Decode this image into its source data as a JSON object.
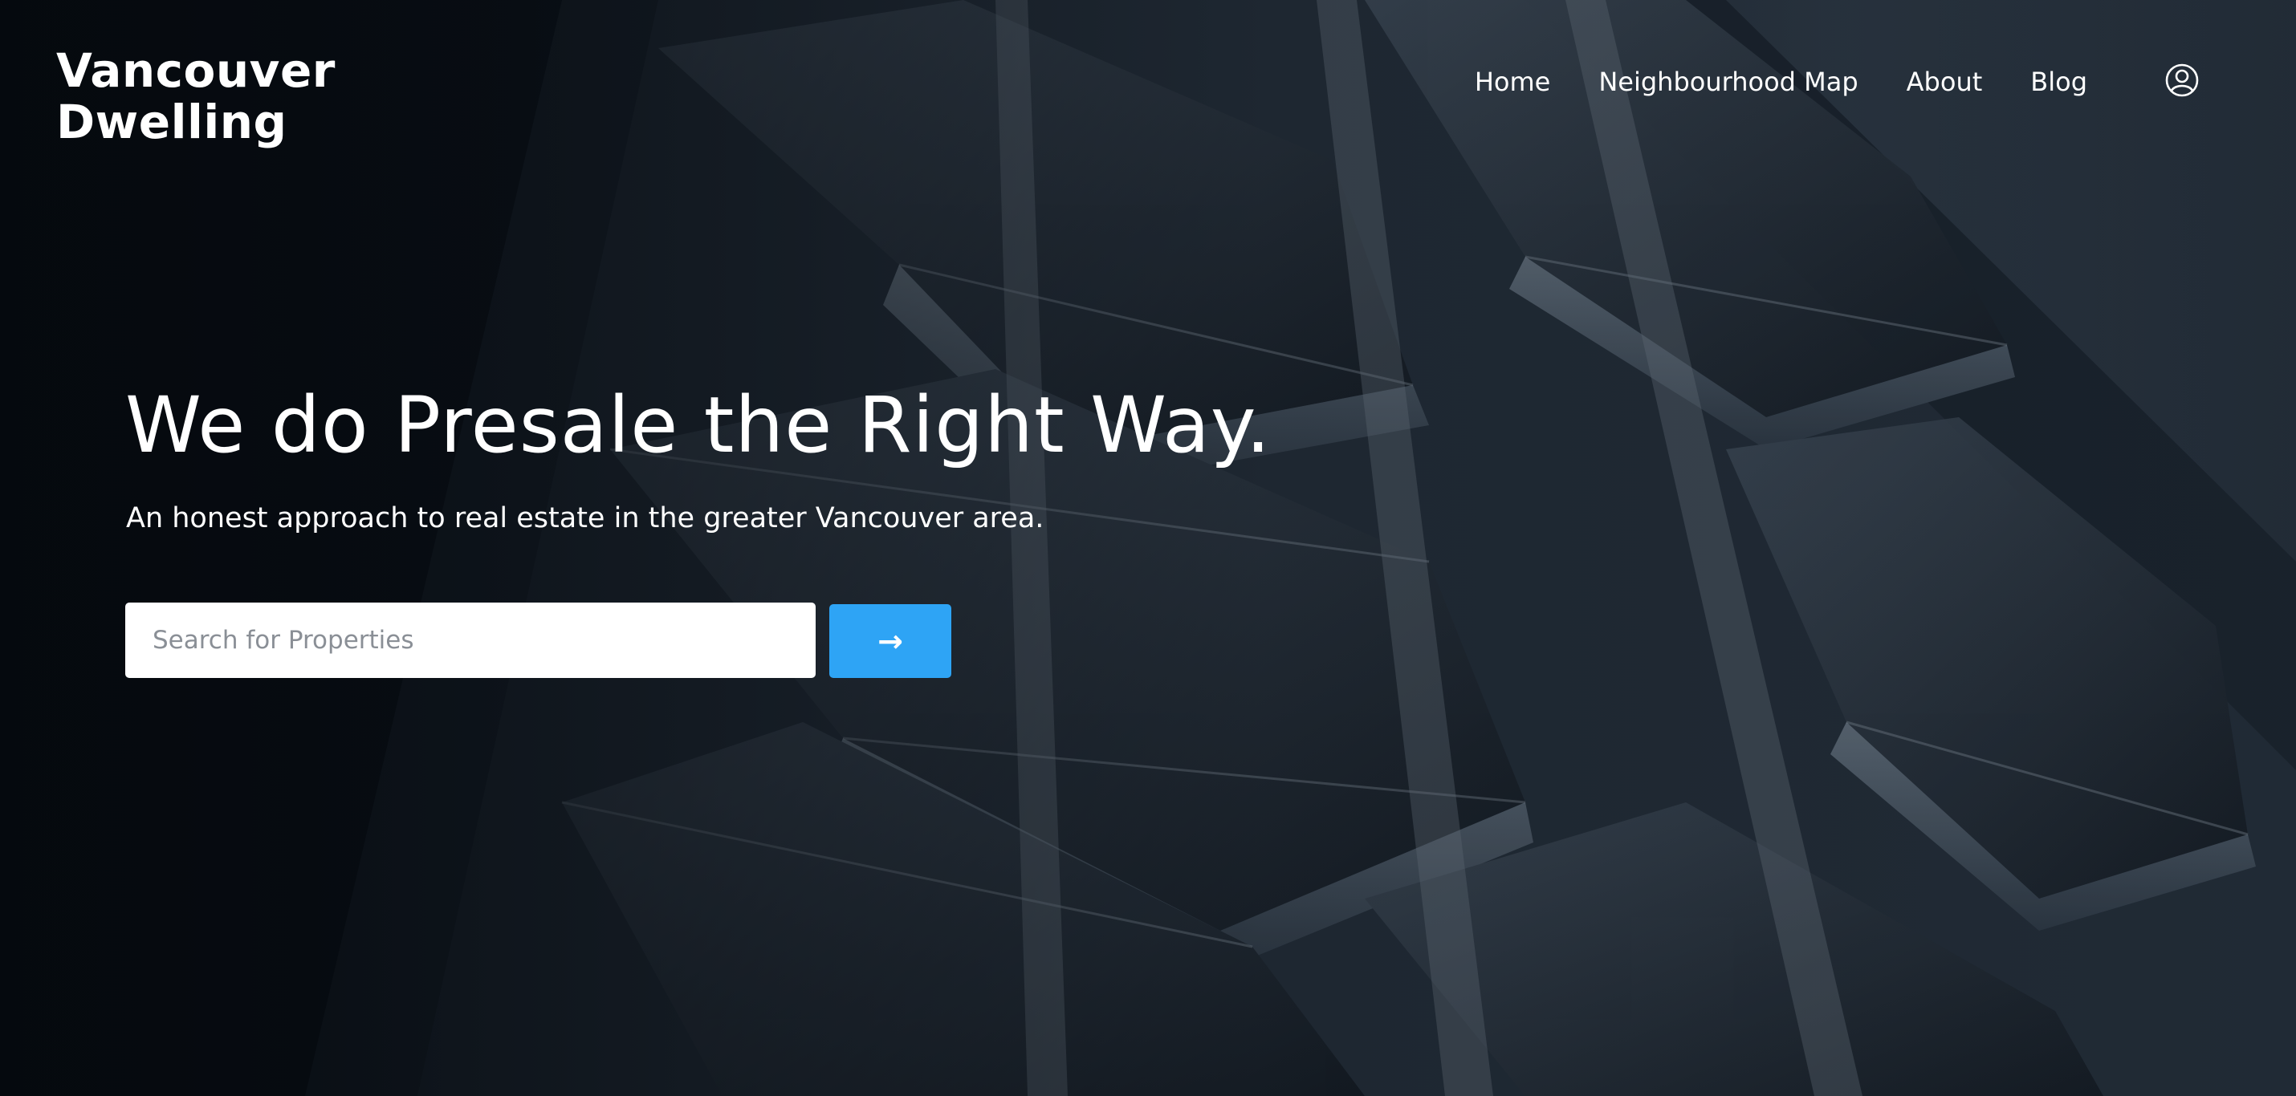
{
  "brand": {
    "line1": "Vancouver",
    "line2": "Dwelling"
  },
  "nav": {
    "items": [
      {
        "label": "Home"
      },
      {
        "label": "Neighbourhood Map"
      },
      {
        "label": "About"
      },
      {
        "label": "Blog"
      }
    ],
    "account_icon": "user-circle-icon"
  },
  "hero": {
    "headline": "We do Presale the Right Way.",
    "subheadline": "An honest approach to real estate in the greater Vancouver area.",
    "background": "building-facade-photo"
  },
  "search": {
    "placeholder": "Search for Properties",
    "value": "",
    "button_label": "→",
    "button_icon": "arrow-right-icon"
  },
  "colors": {
    "accent": "#2ea4f5",
    "text": "#ffffff",
    "background": "#0b1119"
  }
}
